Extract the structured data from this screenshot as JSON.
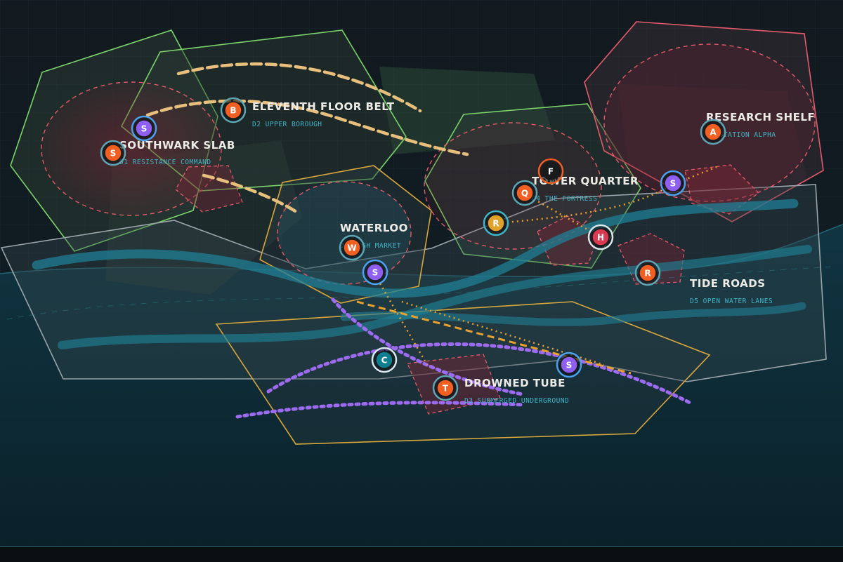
{
  "colors": {
    "background_top": "#121a20",
    "water": "#0e3a46",
    "grid": "#1b2a33",
    "district_green": "#7bd46a",
    "district_gold": "#d8a73c",
    "district_red": "#e35a6a",
    "district_grey": "#9aa4aa",
    "river": "#1f7f94",
    "route_sand": "#e8bf7d",
    "route_purple": "#9d6bf0",
    "route_orange": "#e8a12d",
    "label_sub": "#3fb6c8",
    "marker_orange": "#f25f22",
    "marker_purple": "#8e5ff0",
    "marker_teal": "#0d7f91",
    "marker_gold": "#e0a22a",
    "marker_red": "#d93a52",
    "marker_dark": "#1a1a1a"
  },
  "districts": [
    {
      "id": "southwark",
      "title": "SOUTHWARK SLAB",
      "subtitle": "D1 RESISTANCE COMMAND"
    },
    {
      "id": "eleventh",
      "title": "ELEVENTH FLOOR BELT",
      "subtitle": "D2 UPPER BOROUGH"
    },
    {
      "id": "waterloo",
      "title": "WATERLOO",
      "subtitle": "D3 HIGH MARKET"
    },
    {
      "id": "tower",
      "title": "TOWER QUARTER",
      "subtitle": "D4 THE FORTRESS"
    },
    {
      "id": "research",
      "title": "RESEARCH SHELF",
      "subtitle": "D6 STATION ALPHA"
    },
    {
      "id": "tide",
      "title": "TIDE ROADS",
      "subtitle": "D5 OPEN WATER LANES"
    },
    {
      "id": "drowned",
      "title": "DROWNED TUBE",
      "subtitle": "D3 SUBMERGED UNDERGROUND"
    }
  ],
  "markers": [
    {
      "letter": "S",
      "kind": "purple"
    },
    {
      "letter": "S",
      "kind": "orange"
    },
    {
      "letter": "B",
      "kind": "orange"
    },
    {
      "letter": "W",
      "kind": "orange"
    },
    {
      "letter": "S",
      "kind": "purple"
    },
    {
      "letter": "F",
      "kind": "dark"
    },
    {
      "letter": "Q",
      "kind": "orange"
    },
    {
      "letter": "R",
      "kind": "gold"
    },
    {
      "letter": "H",
      "kind": "red"
    },
    {
      "letter": "R",
      "kind": "orange"
    },
    {
      "letter": "A",
      "kind": "orange"
    },
    {
      "letter": "S",
      "kind": "purple"
    },
    {
      "letter": "C",
      "kind": "teal"
    },
    {
      "letter": "S",
      "kind": "purple"
    },
    {
      "letter": "T",
      "kind": "orange"
    }
  ]
}
